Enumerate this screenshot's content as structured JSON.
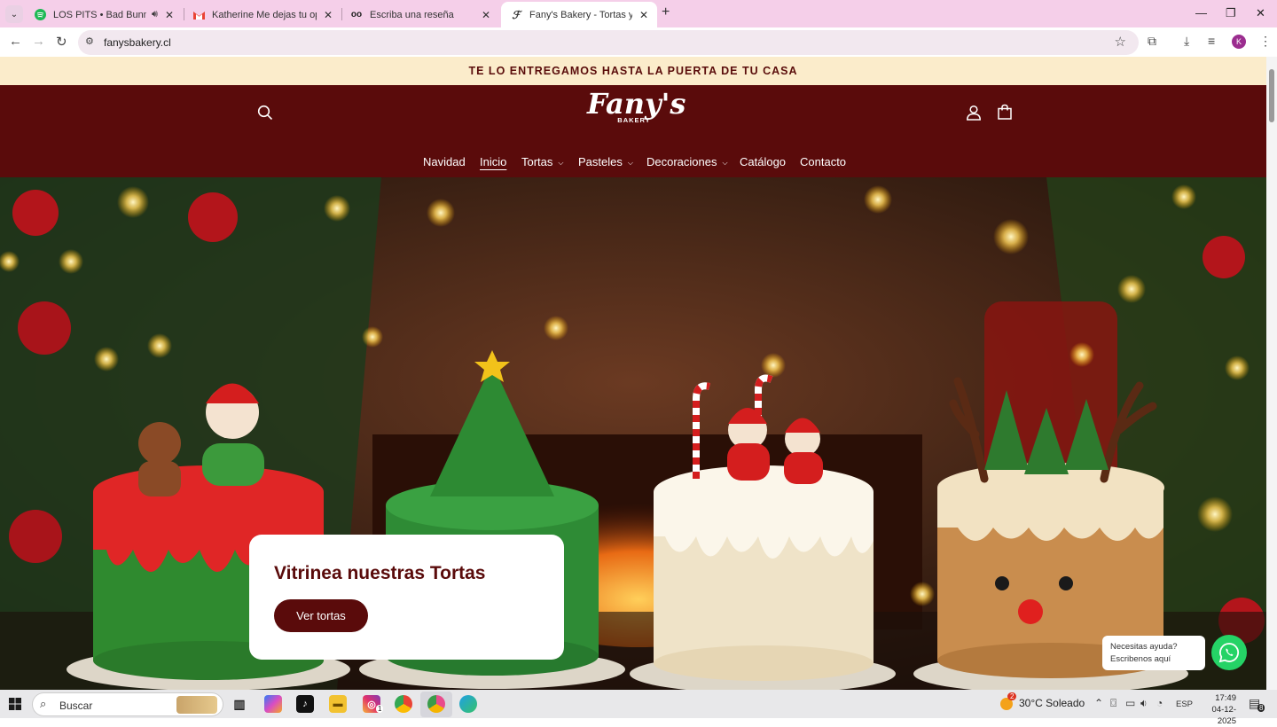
{
  "browser": {
    "tabs": [
      {
        "title": "LOS PITS • Bad Bunny",
        "favicon": "spotify-icon",
        "audio": true
      },
      {
        "title": "Katherine Me dejas tu opinión",
        "favicon": "gmail-icon"
      },
      {
        "title": "Escriba una reseña",
        "favicon": "review-icon"
      },
      {
        "title": "Fany's Bakery - Tortas y Pastele",
        "favicon": "bakery-icon",
        "active": true
      }
    ],
    "url": "fanysbakery.cl",
    "profile_initial": "K"
  },
  "site": {
    "announcement": "TE LO ENTREGAMOS HASTA LA PUERTA DE TU CASA",
    "logo": {
      "main": "Fany's",
      "sub": "BAKERY"
    },
    "menu": [
      {
        "label": "Navidad",
        "active": false,
        "dropdown": false
      },
      {
        "label": "Inicio",
        "active": true,
        "dropdown": false
      },
      {
        "label": "Tortas",
        "active": false,
        "dropdown": true
      },
      {
        "label": "Pasteles",
        "active": false,
        "dropdown": true
      },
      {
        "label": "Decoraciones",
        "active": false,
        "dropdown": true
      },
      {
        "label": "Catálogo",
        "active": false,
        "dropdown": false
      },
      {
        "label": "Contacto",
        "active": false,
        "dropdown": false
      }
    ],
    "hero": {
      "title": "Vitrinea nuestras Tortas",
      "button": "Ver tortas"
    },
    "whatsapp": {
      "line1": "Necesitas ayuda?",
      "line2": "Escribenos aquí"
    },
    "colors": {
      "brand": "#5a0b0b",
      "announcement_bg": "#fbeccb",
      "whatsapp": "#25d366"
    }
  },
  "taskbar": {
    "search_placeholder": "Buscar",
    "weather": "30°C  Soleado",
    "weather_badge": "2",
    "language": "ESP",
    "time": "17:49",
    "date": "04-12-2025",
    "notifications": "8",
    "instagram_badge": "1"
  }
}
